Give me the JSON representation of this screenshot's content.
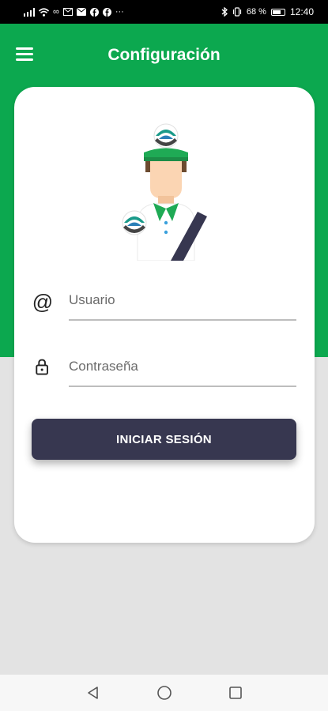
{
  "status_bar": {
    "battery_percent": "68 %",
    "battery_level": 0.68,
    "time": "12:40",
    "more_indicator": "···"
  },
  "app_bar": {
    "title": "Configuración"
  },
  "login_form": {
    "username": {
      "placeholder": "Usuario",
      "value": ""
    },
    "password": {
      "placeholder": "Contraseña",
      "value": ""
    },
    "submit_label": "INICIAR SESIÓN"
  },
  "colors": {
    "primary_green": "#0ca84f",
    "button_dark": "#373750",
    "background_grey": "#e3e3e3"
  },
  "icons": {
    "menu": "hamburger-menu-icon",
    "username": "at-sign-icon",
    "password": "lock-icon",
    "nav_back": "triangle-back-icon",
    "nav_home": "circle-home-icon",
    "nav_recents": "square-recents-icon"
  }
}
